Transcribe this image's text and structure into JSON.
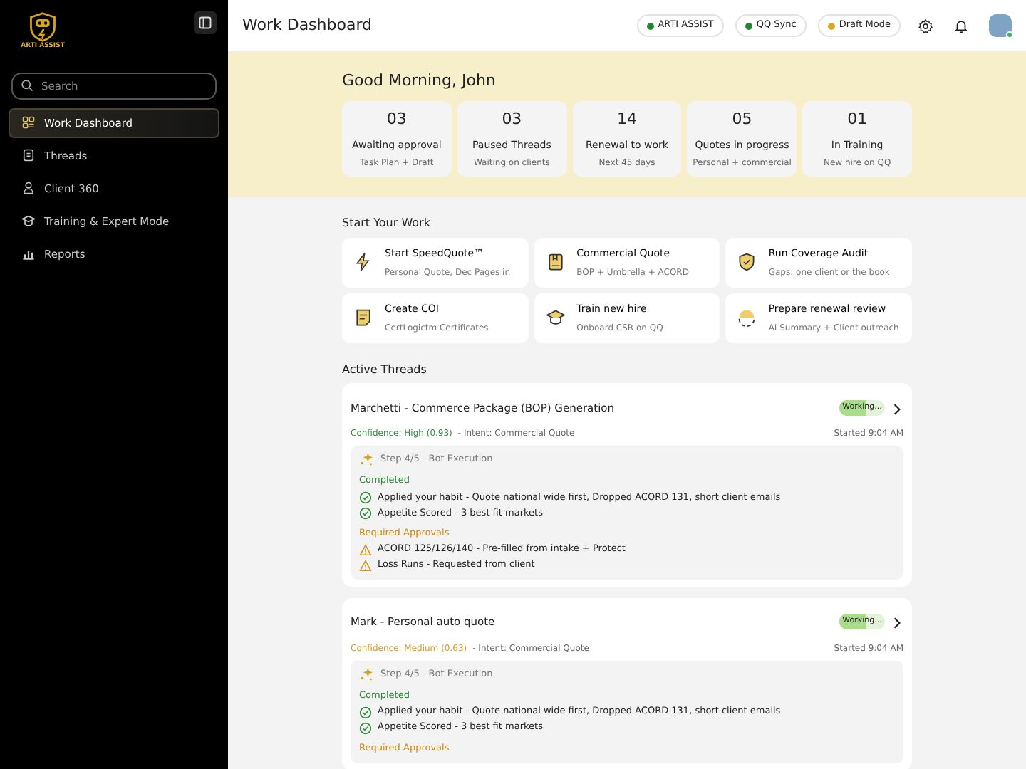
{
  "sidebar": {
    "logo_text": "ARTI ASSIST",
    "search": {
      "placeholder": "Search"
    },
    "items": [
      {
        "label": "Work Dashboard",
        "selected": true
      },
      {
        "label": "Threads",
        "selected": false
      },
      {
        "label": "Client 360",
        "selected": false
      },
      {
        "label": "Training & Expert Mode",
        "selected": false
      },
      {
        "label": "Reports",
        "selected": false
      }
    ]
  },
  "header": {
    "title": "Work Dashboard",
    "pills": [
      {
        "label": "ARTI ASSIST",
        "color": "#1e8a2e"
      },
      {
        "label": "QQ Sync",
        "color": "#1e8a2e"
      },
      {
        "label": "Draft Mode",
        "color": "#e0a81e"
      }
    ],
    "avatar": {
      "online": true
    }
  },
  "greeting": "Good Morning, John",
  "stats": [
    {
      "value": "03",
      "label": "Awaiting approval",
      "sub": "Task Plan + Draft"
    },
    {
      "value": "03",
      "label": "Paused Threads",
      "sub": "Waiting on clients"
    },
    {
      "value": "14",
      "label": "Renewal to work",
      "sub": "Next 45 days"
    },
    {
      "value": "05",
      "label": "Quotes in progress",
      "sub": "Personal + commercial"
    },
    {
      "value": "01",
      "label": "In Training",
      "sub": "New hire on QQ"
    }
  ],
  "start_work": {
    "title": "Start Your Work",
    "items": [
      {
        "title": "Start SpeedQuote™",
        "sub": "Personal Quote, Dec Pages in"
      },
      {
        "title": "Commercial Quote",
        "sub": "BOP + Umbrella + ACORD"
      },
      {
        "title": "Run Coverage Audit",
        "sub": "Gaps: one client or the book"
      },
      {
        "title": "Create COI",
        "sub": "CertLogictm Certificates"
      },
      {
        "title": "Train new hire",
        "sub": "Onboard CSR on QQ"
      },
      {
        "title": "Prepare renewal review",
        "sub": "AI Summary + Client outreach"
      }
    ]
  },
  "active_threads": {
    "title": "Active Threads",
    "threads": [
      {
        "title": "Marchetti - Commerce Package (BOP) Generation",
        "status": "Working...",
        "level": 0.6,
        "confidence": {
          "text": "Confidence: High (0.93)",
          "color": "#2e8b3a"
        },
        "intent": "- Intent: Commercial Quote",
        "started": "Started 9:04 AM",
        "step": "Step 4/5 - Bot Execution",
        "completed_title": "Completed",
        "completed": [
          "Applied your habit - Quote national wide first, Dropped ACORD 131, short client emails",
          "Appetite Scored - 3 best fit markets"
        ],
        "approvals_title": "Required Approvals",
        "approvals": [
          "ACORD 125/126/140 - Pre-filled from intake + Protect",
          "Loss Runs - Requested from client"
        ]
      },
      {
        "title": "Mark - Personal auto quote",
        "status": "Working...",
        "level": 0.6,
        "confidence": {
          "text": "Confidence: Medium (0.63)",
          "color": "#d99a1e"
        },
        "intent": "- Intent: Commercial Quote",
        "started": "Started 9:04 AM",
        "step": "Step 4/5 - Bot Execution",
        "completed_title": "Completed",
        "completed": [
          "Applied your habit - Quote national wide first, Dropped ACORD 131, short client emails",
          "Appetite Scored - 3 best fit markets"
        ],
        "approvals_title": "Required Approvals"
      }
    ]
  }
}
